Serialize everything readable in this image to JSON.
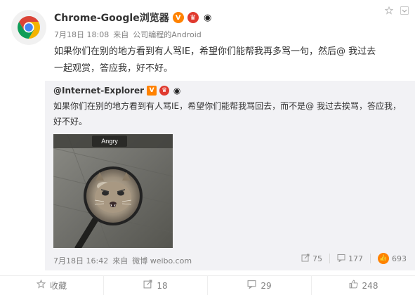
{
  "post": {
    "author": {
      "name": "Chrome-Google浏览器",
      "badges": [
        "v-badge",
        "vip-badge",
        "panda-badge"
      ]
    },
    "meta": {
      "date": "7月18日 18:08",
      "from_label": "来自",
      "source": "公司编程的Android"
    },
    "text_lines": [
      "如果你们在别的地方看到有人骂IE，希望你们能帮我再多骂一句，然后@ 我过去",
      "一起观赏，答应我，好不好。"
    ]
  },
  "repost": {
    "author": "@Internet-Explorer",
    "badges": [
      "v-badge",
      "vip-badge",
      "panda-badge"
    ],
    "text_lines": [
      "如果你们在别的地方看到有人骂IE，希望你们能帮我骂回去，而不是@ 我过去挨骂，答应我，",
      "好不好。"
    ],
    "image": {
      "caption": "Angry"
    },
    "meta": {
      "date": "7月18日 16:42",
      "from_label": "来自",
      "source": "微博 weibo.com"
    },
    "actions": {
      "reposts": "75",
      "comments": "177",
      "likes": "693"
    }
  },
  "action_bar": {
    "favorite": "收藏",
    "repost": "18",
    "comment": "29",
    "like": "248"
  }
}
